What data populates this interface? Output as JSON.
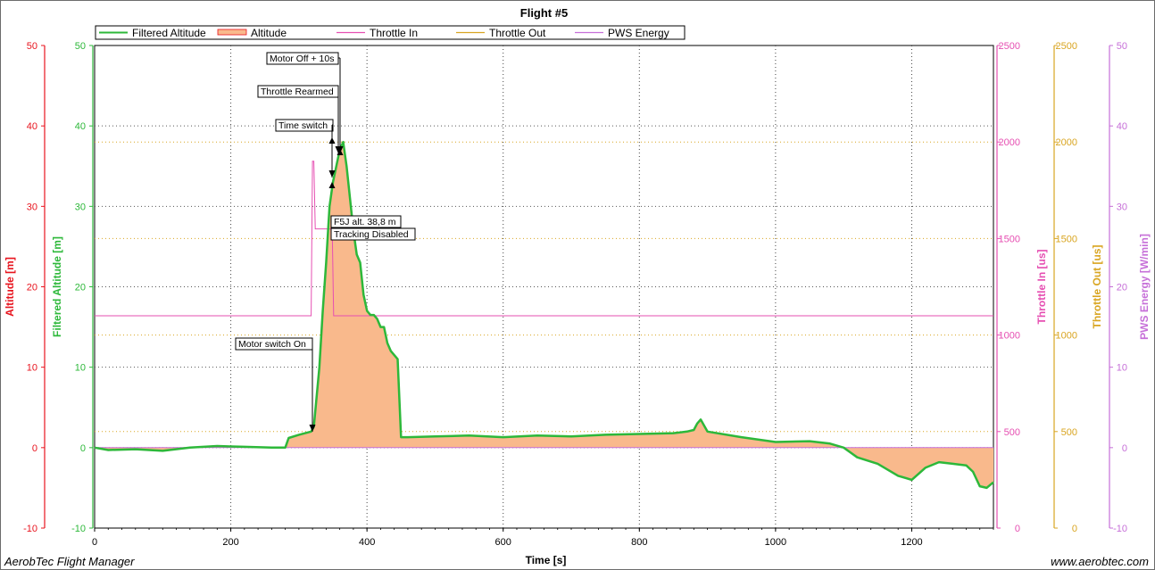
{
  "chart_data": {
    "type": "line",
    "title": "Flight #5",
    "xlabel": "Time [s]",
    "xlim": [
      0,
      1320
    ],
    "x_ticks": [
      0,
      200,
      400,
      600,
      800,
      1000,
      1200
    ],
    "axes": [
      {
        "key": "altitude",
        "label": "Altitude [m]",
        "color": "#e8141e",
        "min": -10,
        "max": 50,
        "ticks": [
          -10,
          0,
          10,
          20,
          30,
          40,
          50
        ]
      },
      {
        "key": "filtered_altitude",
        "label": "Filtered Altitude [m]",
        "color": "#2db83a",
        "min": -10,
        "max": 50,
        "ticks": [
          -10,
          0,
          10,
          20,
          30,
          40,
          50
        ]
      },
      {
        "key": "throttle_in",
        "label": "Throttle In [us]",
        "color": "#e64fb2",
        "min": 0,
        "max": 2500,
        "ticks": [
          0,
          500,
          1000,
          1500,
          2000,
          2500
        ]
      },
      {
        "key": "throttle_out",
        "label": "Throttle Out [us]",
        "color": "#d9a521",
        "min": 0,
        "max": 2500,
        "ticks": [
          0,
          500,
          1000,
          1500,
          2000,
          2500
        ]
      },
      {
        "key": "pws_energy",
        "label": "PWS Energy [W/min]",
        "color": "#c66fd8",
        "min": -10,
        "max": 50,
        "ticks": [
          -10,
          0,
          10,
          20,
          30,
          40,
          50
        ]
      }
    ],
    "legend": {
      "placement": "top",
      "entries": [
        {
          "name": "Filtered Altitude",
          "color": "#2db83a",
          "style": "line"
        },
        {
          "name": "Altitude",
          "color": "#f9b98c",
          "style": "fill"
        },
        {
          "name": "Throttle In",
          "color": "#e64fb2",
          "style": "line"
        },
        {
          "name": "Throttle Out",
          "color": "#d9a521",
          "style": "line"
        },
        {
          "name": "PWS Energy",
          "color": "#c66fd8",
          "style": "line"
        }
      ]
    },
    "series": [
      {
        "name": "Filtered Altitude",
        "axis": "filtered_altitude",
        "color": "#2db83a",
        "x": [
          0,
          20,
          60,
          100,
          140,
          180,
          220,
          260,
          280,
          285,
          300,
          318,
          322,
          330,
          335,
          340,
          345,
          350,
          355,
          360,
          365,
          370,
          375,
          380,
          385,
          390,
          395,
          400,
          405,
          410,
          415,
          420,
          425,
          430,
          435,
          440,
          445,
          450,
          460,
          500,
          550,
          600,
          650,
          700,
          750,
          800,
          850,
          870,
          880,
          885,
          890,
          900,
          950,
          1000,
          1050,
          1080,
          1100,
          1120,
          1150,
          1180,
          1200,
          1220,
          1240,
          1260,
          1280,
          1290,
          1300,
          1310,
          1320
        ],
        "y": [
          0.0,
          -0.3,
          -0.2,
          -0.4,
          0.0,
          0.2,
          0.1,
          0.0,
          0.0,
          1.2,
          1.6,
          2.0,
          2.6,
          10,
          17,
          23,
          30,
          33,
          35,
          37,
          38,
          35,
          31,
          27,
          24,
          23,
          19,
          17,
          16.5,
          16.5,
          16,
          15,
          15,
          13,
          12,
          11.5,
          11,
          1.3,
          1.3,
          1.4,
          1.5,
          1.3,
          1.5,
          1.4,
          1.6,
          1.7,
          1.8,
          2.0,
          2.2,
          3.0,
          3.5,
          2.0,
          1.3,
          0.7,
          0.8,
          0.5,
          0.0,
          -1.2,
          -2.0,
          -3.5,
          -4.0,
          -2.5,
          -1.8,
          -2.0,
          -2.2,
          -3.0,
          -4.8,
          -5.0,
          -4.3
        ]
      },
      {
        "name": "Altitude",
        "axis": "altitude",
        "color": "#f9b98c",
        "x": [
          0,
          20,
          60,
          100,
          140,
          180,
          220,
          260,
          280,
          285,
          300,
          318,
          322,
          330,
          335,
          340,
          345,
          350,
          355,
          360,
          365,
          370,
          375,
          380,
          385,
          390,
          395,
          400,
          405,
          410,
          415,
          420,
          425,
          430,
          435,
          440,
          445,
          450,
          460,
          500,
          550,
          600,
          650,
          700,
          750,
          800,
          850,
          870,
          880,
          885,
          890,
          900,
          950,
          1000,
          1050,
          1080,
          1100,
          1120,
          1150,
          1180,
          1200,
          1220,
          1240,
          1260,
          1280,
          1290,
          1300,
          1310,
          1320
        ],
        "y": [
          0.0,
          -0.3,
          -0.2,
          -0.4,
          0.0,
          0.2,
          0.1,
          0.0,
          0.0,
          1.2,
          1.6,
          2.0,
          2.6,
          10,
          17,
          23,
          30,
          33,
          35,
          37,
          38,
          35,
          31,
          27,
          24,
          23,
          19,
          17,
          16.5,
          16.5,
          16,
          15,
          15,
          13,
          12,
          11.5,
          11,
          1.3,
          1.3,
          1.4,
          1.5,
          1.3,
          1.5,
          1.4,
          1.6,
          1.7,
          1.8,
          2.0,
          2.2,
          3.0,
          3.5,
          2.0,
          1.3,
          0.7,
          0.8,
          0.5,
          0.0,
          -1.2,
          -2.0,
          -3.5,
          -4.0,
          -2.5,
          -1.8,
          -2.0,
          -2.2,
          -3.0,
          -4.8,
          -5.0,
          -4.3
        ]
      },
      {
        "name": "Throttle In",
        "axis": "throttle_in",
        "color": "#e64fb2",
        "x": [
          0,
          318,
          320,
          322,
          324,
          326,
          340,
          346,
          348,
          349,
          351,
          360,
          400,
          1320
        ],
        "y": [
          1100,
          1100,
          1900,
          1900,
          1550,
          1550,
          1550,
          1550,
          1550,
          1550,
          1100,
          1100,
          1100,
          1100
        ]
      },
      {
        "name": "PWS Energy",
        "axis": "pws_energy",
        "color": "#c66fd8",
        "x": [
          0,
          1320
        ],
        "y": [
          0,
          0
        ]
      }
    ],
    "annotations": [
      {
        "text": "Motor Off + 10s",
        "x": 360,
        "y": 37
      },
      {
        "text": "Throttle Rearmed",
        "x": 360,
        "y": 37
      },
      {
        "text": "Time switch",
        "x": 348,
        "y": 38.5
      },
      {
        "text": "F5J alt. 38,8 m",
        "x": 350,
        "y": 33
      },
      {
        "text": "Tracking Disabled",
        "x": 350,
        "y": 33
      },
      {
        "text": "Motor switch On",
        "x": 318,
        "y": 2
      }
    ],
    "grid": true
  },
  "footer": {
    "left": "AerobTec Flight Manager",
    "right": "www.aerobtec.com"
  }
}
